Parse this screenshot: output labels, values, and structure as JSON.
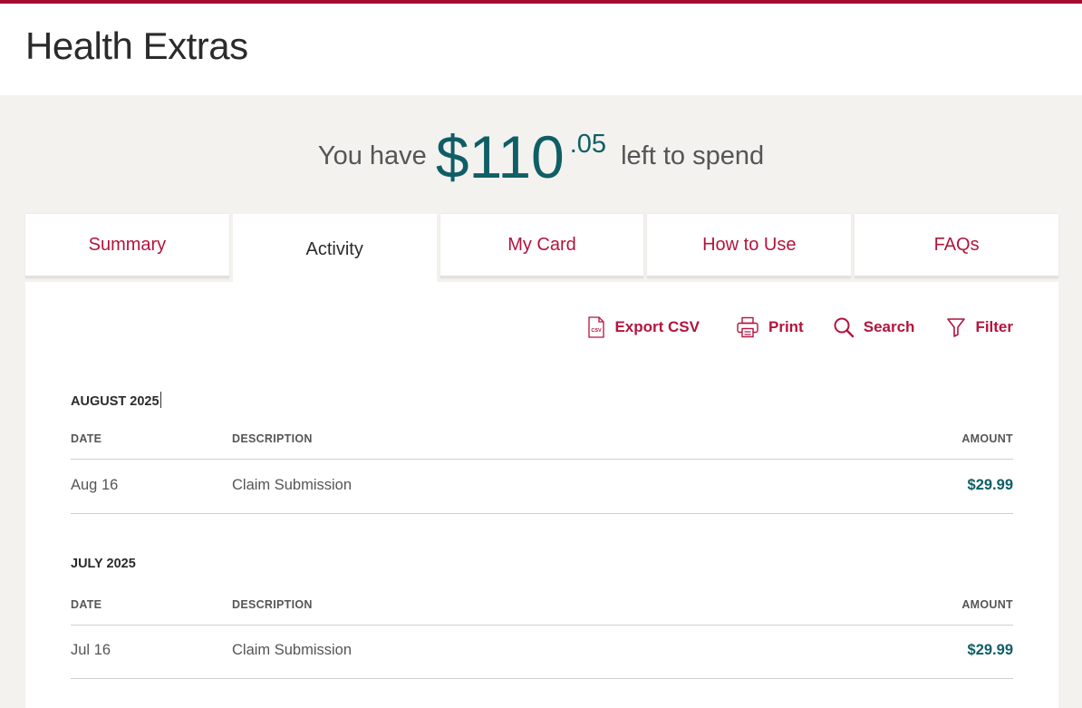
{
  "app": {
    "title": "Health Extras"
  },
  "balance": {
    "prefix": "You have",
    "dollars": "$110",
    "cents": ".05",
    "suffix": "left to spend"
  },
  "tabs": [
    {
      "label": "Summary",
      "active": false
    },
    {
      "label": "Activity",
      "active": true
    },
    {
      "label": "My Card",
      "active": false
    },
    {
      "label": "How to Use",
      "active": false
    },
    {
      "label": "FAQs",
      "active": false
    }
  ],
  "toolbar": {
    "export": "Export CSV",
    "export_icon_text": "CSV",
    "print": "Print",
    "search": "Search",
    "filter": "Filter"
  },
  "columns": {
    "date": "DATE",
    "description": "DESCRIPTION",
    "amount": "AMOUNT"
  },
  "months": [
    {
      "label": "AUGUST 2025",
      "rows": [
        {
          "date": "Aug 16",
          "description": "Claim Submission",
          "amount": "$29.99"
        }
      ]
    },
    {
      "label": "JULY 2025",
      "rows": [
        {
          "date": "Jul 16",
          "description": "Claim Submission",
          "amount": "$29.99"
        }
      ]
    }
  ],
  "colors": {
    "brand": "#a3102f",
    "accent_link": "#b3143d",
    "money": "#0f5e66"
  }
}
